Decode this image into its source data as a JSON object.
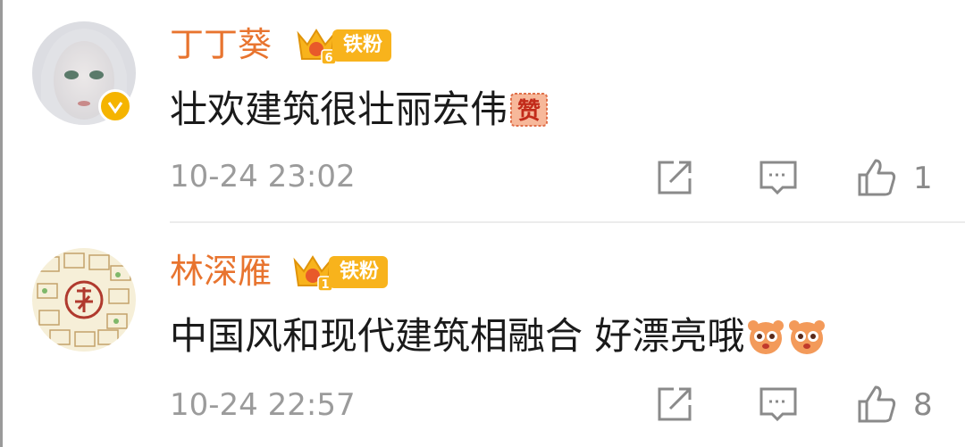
{
  "colors": {
    "username": "#e8742f",
    "badge": "#f8b31c",
    "timestamp": "#9b9b9b"
  },
  "comments": [
    {
      "username": "丁丁葵",
      "badge_level": "6",
      "badge_label": "铁粉",
      "text": "壮欢建筑很壮丽宏伟",
      "emojis": [
        "赞"
      ],
      "timestamp": "10-24 23:02",
      "like_count": "1",
      "verified": true
    },
    {
      "username": "林深雁",
      "badge_level": "1",
      "badge_label": "铁粉",
      "text": "中国风和现代建筑相融合 好漂亮哦",
      "emojis": [
        "doge-face",
        "doge-face"
      ],
      "timestamp": "10-24 22:57",
      "like_count": "8",
      "verified": false
    }
  ],
  "icons": {
    "share": "share-icon",
    "reply": "comment-icon",
    "like": "thumbs-up-icon"
  }
}
